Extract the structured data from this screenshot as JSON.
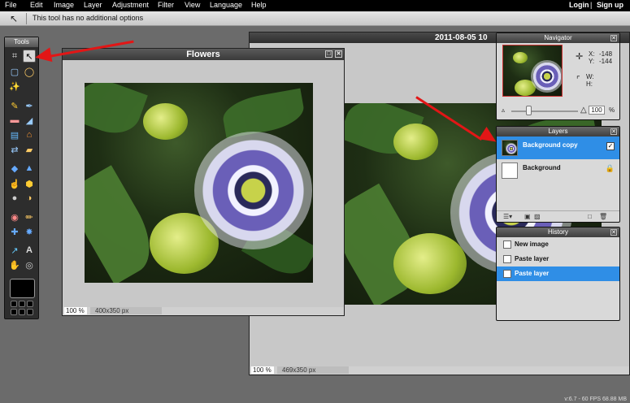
{
  "menubar": {
    "items": [
      "File",
      "Edit",
      "Image",
      "Layer",
      "Adjustment",
      "Filter",
      "View",
      "Language",
      "Help"
    ],
    "login": "Login",
    "separator": "|",
    "signup": "Sign up"
  },
  "options_bar": {
    "text": "This tool has no additional options"
  },
  "tools_panel": {
    "title": "Tools"
  },
  "flowers_window": {
    "title": "Flowers",
    "zoom": "100",
    "zoom_unit": "%",
    "size": "400x350 px"
  },
  "background_window": {
    "title": "2011-08-05 10",
    "zoom": "100",
    "zoom_unit": "%",
    "size": "469x350 px"
  },
  "navigator": {
    "title": "Navigator",
    "x_label": "X:",
    "x_value": "-148",
    "y_label": "Y:",
    "y_value": "-144",
    "w_label": "W:",
    "h_label": "H:",
    "zoom": "100",
    "zoom_unit": "%"
  },
  "layers": {
    "title": "Layers",
    "items": [
      {
        "name": "Background copy",
        "selected": true
      },
      {
        "name": "Background",
        "selected": false
      }
    ]
  },
  "history": {
    "title": "History",
    "items": [
      {
        "label": "New image",
        "selected": false
      },
      {
        "label": "Paste layer",
        "selected": false
      },
      {
        "label": "Paste layer",
        "selected": true
      }
    ]
  },
  "footer": {
    "text": "v:6.7 - 60 FPS 68.88 MB"
  }
}
